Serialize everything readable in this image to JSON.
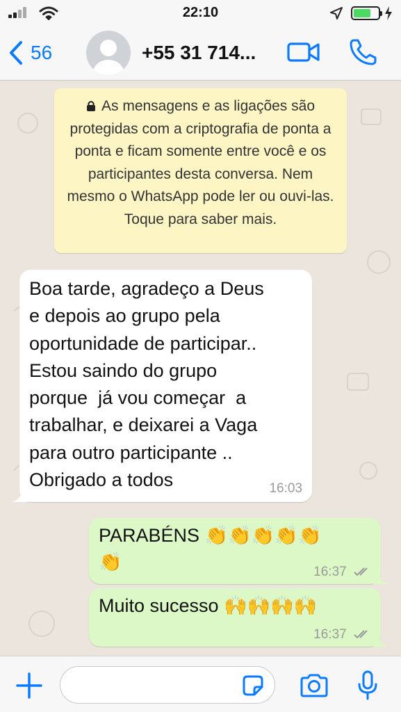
{
  "status_bar": {
    "time": "22:10",
    "battery_level": 0.7
  },
  "header": {
    "back_count": "56",
    "contact_name": "+55 31 714..."
  },
  "encryption_notice": {
    "text": "As mensagens e as ligações são protegidas com a criptografia de ponta a ponta e ficam somente entre você e os participantes desta conversa. Nem mesmo o WhatsApp pode ler ou ouvi-las. Toque para saber mais."
  },
  "messages": [
    {
      "direction": "incoming",
      "text": "Boa tarde, agradeço a Deus\ne depois ao grupo pela\noportunidade de participar..\nEstou saindo do grupo\nporque  já vou começar  a\ntrabalhar, e deixarei a Vaga\npara outro participante ..\nObrigado a todos",
      "time": "16:03"
    },
    {
      "direction": "outgoing",
      "text": "PARABÉNS 👏👏👏👏👏\n👏",
      "time": "16:37",
      "status": "read"
    },
    {
      "direction": "outgoing",
      "text": "Muito sucesso 🙌🙌🙌🙌",
      "time": "16:37",
      "status": "read"
    }
  ],
  "input_bar": {
    "placeholder": ""
  },
  "colors": {
    "accent": "#0a7aff",
    "chat_bg": "#ece5dd",
    "incoming_bubble": "#ffffff",
    "outgoing_bubble": "#dcf8c6",
    "notice_bg": "#fdf5c4",
    "battery_fill": "#4cd964"
  },
  "icons": [
    "signal-icon",
    "wifi-icon",
    "location-arrow-icon",
    "battery-icon",
    "charging-bolt-icon",
    "chevron-left-icon",
    "avatar-placeholder-icon",
    "video-camera-icon",
    "phone-icon",
    "lock-icon",
    "double-check-icon",
    "plus-icon",
    "sticker-icon",
    "camera-icon",
    "microphone-icon"
  ]
}
